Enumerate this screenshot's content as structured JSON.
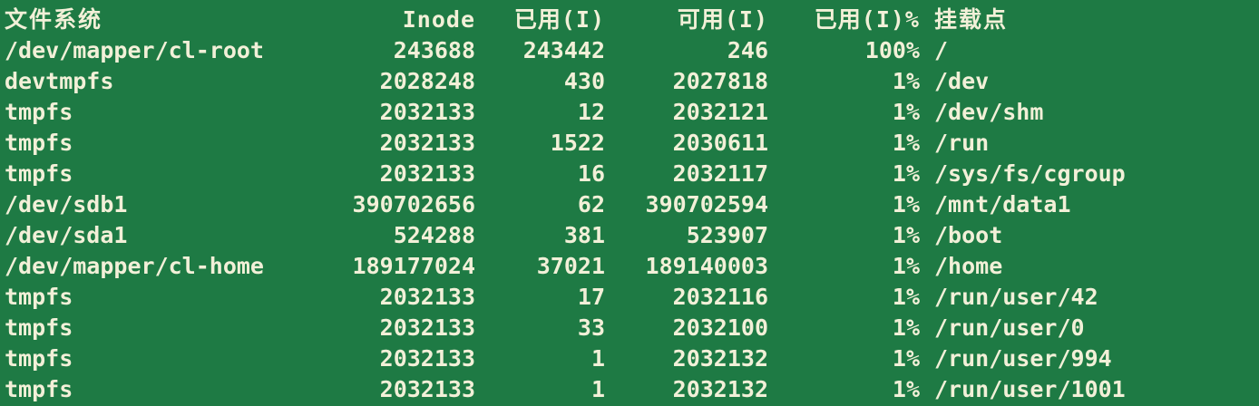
{
  "terminal": {
    "bg_color": "#1e7a44",
    "fg_color": "#f2f0d8",
    "partial_top_line": "[            ]$",
    "headers": {
      "filesystem": "文件系统",
      "inodes": "Inode",
      "iused": "已用(I)",
      "ifree": "可用(I)",
      "iuse_pct": "已用(I)%",
      "mounted_on": "挂载点"
    },
    "rows": [
      {
        "fs": "/dev/mapper/cl-root",
        "inodes": "243688",
        "iused": "243442",
        "ifree": "246",
        "pct": "100%",
        "mount": "/"
      },
      {
        "fs": "devtmpfs",
        "inodes": "2028248",
        "iused": "430",
        "ifree": "2027818",
        "pct": "1%",
        "mount": "/dev"
      },
      {
        "fs": "tmpfs",
        "inodes": "2032133",
        "iused": "12",
        "ifree": "2032121",
        "pct": "1%",
        "mount": "/dev/shm"
      },
      {
        "fs": "tmpfs",
        "inodes": "2032133",
        "iused": "1522",
        "ifree": "2030611",
        "pct": "1%",
        "mount": "/run"
      },
      {
        "fs": "tmpfs",
        "inodes": "2032133",
        "iused": "16",
        "ifree": "2032117",
        "pct": "1%",
        "mount": "/sys/fs/cgroup"
      },
      {
        "fs": "/dev/sdb1",
        "inodes": "390702656",
        "iused": "62",
        "ifree": "390702594",
        "pct": "1%",
        "mount": "/mnt/data1"
      },
      {
        "fs": "/dev/sda1",
        "inodes": "524288",
        "iused": "381",
        "ifree": "523907",
        "pct": "1%",
        "mount": "/boot"
      },
      {
        "fs": "/dev/mapper/cl-home",
        "inodes": "189177024",
        "iused": "37021",
        "ifree": "189140003",
        "pct": "1%",
        "mount": "/home"
      },
      {
        "fs": "tmpfs",
        "inodes": "2032133",
        "iused": "17",
        "ifree": "2032116",
        "pct": "1%",
        "mount": "/run/user/42"
      },
      {
        "fs": "tmpfs",
        "inodes": "2032133",
        "iused": "33",
        "ifree": "2032100",
        "pct": "1%",
        "mount": "/run/user/0"
      },
      {
        "fs": "tmpfs",
        "inodes": "2032133",
        "iused": "1",
        "ifree": "2032132",
        "pct": "1%",
        "mount": "/run/user/994"
      },
      {
        "fs": "tmpfs",
        "inodes": "2032133",
        "iused": "1",
        "ifree": "2032132",
        "pct": "1%",
        "mount": "/run/user/1001"
      }
    ]
  }
}
